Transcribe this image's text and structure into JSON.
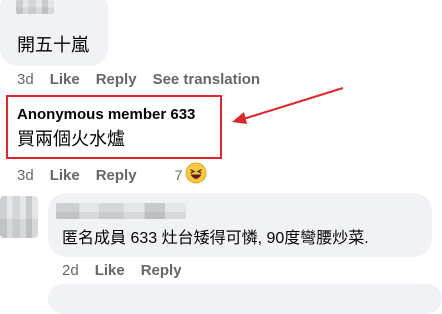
{
  "comment1": {
    "text": "開五十嵐",
    "time": "3d",
    "like": "Like",
    "reply": "Reply",
    "see_translation": "See translation"
  },
  "comment2": {
    "author": "Anonymous member 633",
    "text": "買兩個火水爐",
    "time": "3d",
    "like": "Like",
    "reply": "Reply",
    "reaction_count": "7",
    "reaction_icon": "haha-emoji-icon"
  },
  "comment3": {
    "text": "匿名成員 633 灶台矮得可憐, 90度彎腰炒菜.",
    "time": "2d",
    "like": "Like",
    "reply": "Reply"
  },
  "annotation": {
    "box_color": "#e0262a",
    "arrow_color": "#e0262a"
  }
}
